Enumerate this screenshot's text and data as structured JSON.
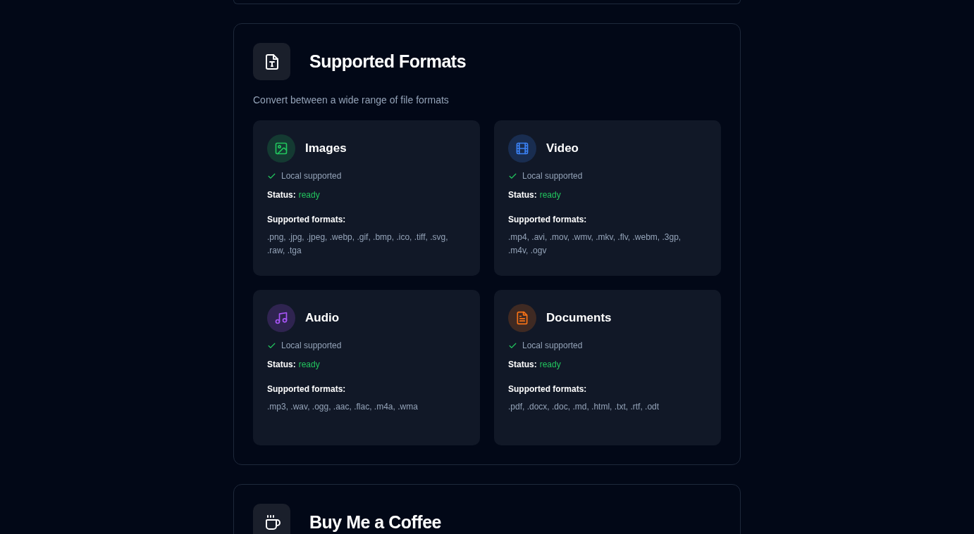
{
  "formats_section": {
    "title": "Supported Formats",
    "subtitle": "Convert between a wide range of file formats",
    "categories": [
      {
        "kind": "image",
        "name": "Images",
        "local": "Local supported",
        "status_label": "Status:",
        "status": "ready",
        "formats_label": "Supported formats:",
        "formats": ".png, .jpg, .jpeg, .webp, .gif, .bmp, .ico, .tiff, .svg, .raw, .tga",
        "color": "#22c55e"
      },
      {
        "kind": "video",
        "name": "Video",
        "local": "Local supported",
        "status_label": "Status:",
        "status": "ready",
        "formats_label": "Supported formats:",
        "formats": ".mp4, .avi, .mov, .wmv, .mkv, .flv, .webm, .3gp, .m4v, .ogv",
        "color": "#3b82f6"
      },
      {
        "kind": "audio",
        "name": "Audio",
        "local": "Local supported",
        "status_label": "Status:",
        "status": "ready",
        "formats_label": "Supported formats:",
        "formats": ".mp3, .wav, .ogg, .aac, .flac, .m4a, .wma",
        "color": "#a855f7"
      },
      {
        "kind": "document",
        "name": "Documents",
        "local": "Local supported",
        "status_label": "Status:",
        "status": "ready",
        "formats_label": "Supported formats:",
        "formats": ".pdf, .docx, .doc, .md, .html, .txt, .rtf, .odt",
        "color": "#f97316"
      }
    ]
  },
  "coffee_section": {
    "title": "Buy Me a Coffee"
  }
}
